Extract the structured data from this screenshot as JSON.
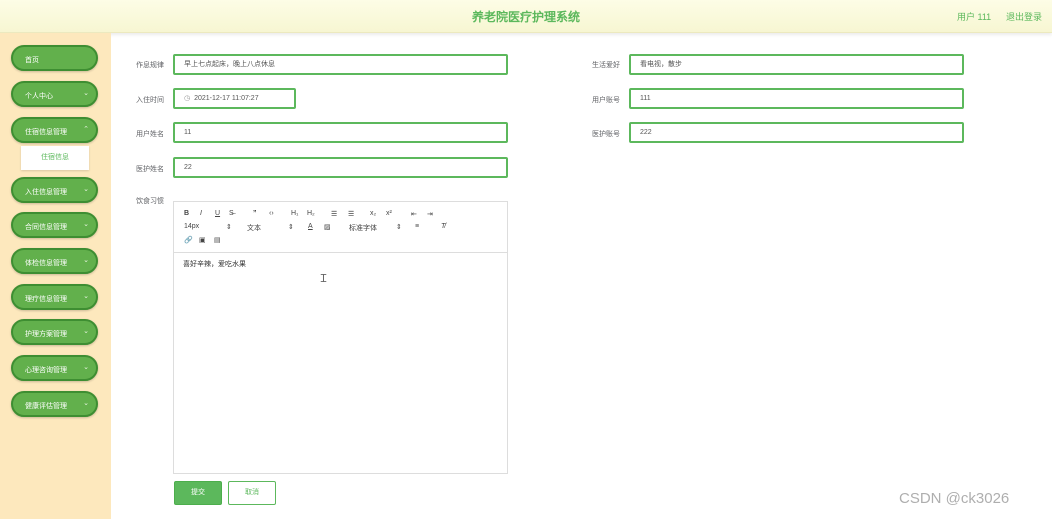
{
  "header": {
    "title": "养老院医疗护理系统",
    "user": "用户 111",
    "logout": "退出登录"
  },
  "sidebar": {
    "items": [
      {
        "label": "首页",
        "chevron": false
      },
      {
        "label": "个人中心",
        "chevron": true
      },
      {
        "label": "住宿信息管理",
        "chevron": true
      },
      {
        "label": "入住信息管理",
        "chevron": true
      },
      {
        "label": "合同信息管理",
        "chevron": true
      },
      {
        "label": "体检信息管理",
        "chevron": true
      },
      {
        "label": "理疗信息管理",
        "chevron": true
      },
      {
        "label": "护理方案管理",
        "chevron": true
      },
      {
        "label": "心理咨询管理",
        "chevron": true
      },
      {
        "label": "健康评估管理",
        "chevron": true
      }
    ],
    "submenu": "住宿信息"
  },
  "form": {
    "routine_label": "作息规律",
    "routine_value": "早上七点起床，晚上八点休息",
    "hobby_label": "生活爱好",
    "hobby_value": "看电视，散步",
    "checkin_label": "入住时间",
    "checkin_value": "2021-12-17 11:07:27",
    "account_label": "用户账号",
    "account_value": "111",
    "username_label": "用户姓名",
    "username_value": "11",
    "nurse_account_label": "医护账号",
    "nurse_account_value": "222",
    "nurse_name_label": "医护姓名",
    "nurse_name_value": "22",
    "diet_label": "饮食习惯"
  },
  "editor": {
    "font_size": "14px",
    "text_type": "文本",
    "font_family": "标准字体",
    "content": "喜好辛辣，爱吃水果",
    "icons": [
      "bold-icon",
      "italic-icon",
      "underline-icon",
      "strikethrough-icon",
      "blockquote-icon",
      "code-block-icon",
      "heading-1-icon",
      "heading-2-icon",
      "ordered-list-icon",
      "bullet-list-icon",
      "subscript-icon",
      "superscript-icon",
      "outdent-icon",
      "indent-icon",
      "font-color-icon",
      "background-color-icon",
      "align-icon",
      "clear-format-icon",
      "link-icon",
      "image-icon",
      "video-icon"
    ]
  },
  "actions": {
    "submit": "提交",
    "cancel": "取消"
  },
  "watermark": "CSDN @ck3026",
  "colors": {
    "accent": "#5cb85c",
    "sidebar_bg": "#fde8bd",
    "header_bg": "#fdfde6"
  }
}
